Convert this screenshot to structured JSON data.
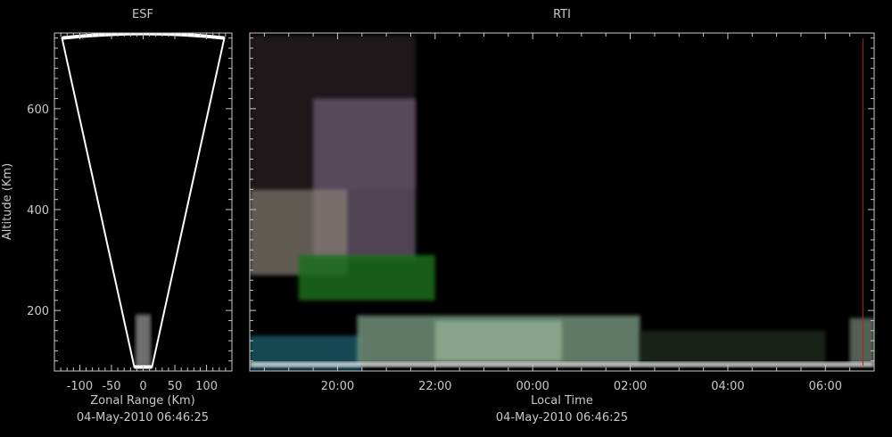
{
  "colors": {
    "background": "#000000",
    "axis": "#c8c8c8",
    "fan_outline": "#ffffff",
    "marker": "#b02020"
  },
  "chart_data": [
    {
      "panel": "ESF",
      "type": "heatmap",
      "title": "ESF",
      "xlabel": "Zonal Range (Km)",
      "ylabel": "Altitude (Km)",
      "timestamp": "04-May-2010 06:46:25",
      "xlim": [
        -140,
        140
      ],
      "ylim": [
        80,
        750
      ],
      "xticks": [
        -100,
        -50,
        0,
        50,
        100
      ],
      "xtick_labels": [
        "-100",
        "-50",
        "0",
        "50",
        "100"
      ],
      "yticks": [
        200,
        400,
        600
      ],
      "ytick_labels": [
        "200",
        "400",
        "600"
      ],
      "fan": {
        "bottom_halfwidth": 14,
        "bottom_altitude": 88,
        "top_halfwidth": 128,
        "top_altitude": 745
      },
      "echo": {
        "x_range": [
          -12,
          12
        ],
        "alt_range": [
          88,
          192
        ],
        "color": "#8a8a8a"
      }
    },
    {
      "panel": "RTI",
      "type": "heatmap",
      "title": "RTI",
      "xlabel": "Local Time",
      "timestamp": "04-May-2010 06:46:25",
      "xlim_hours": [
        18.2,
        31.0
      ],
      "ylim": [
        80,
        750
      ],
      "xticks_hours": [
        20,
        22,
        24,
        26,
        28,
        30
      ],
      "xtick_labels": [
        "20:00",
        "22:00",
        "00:00",
        "02:00",
        "04:00",
        "06:00"
      ],
      "current_time_hours": 30.77,
      "regions": [
        {
          "t": [
            18.2,
            21.6
          ],
          "alt": [
            440,
            745
          ],
          "color": "#3a2a30",
          "opacity": 0.55
        },
        {
          "t": [
            19.5,
            21.6
          ],
          "alt": [
            300,
            620
          ],
          "color": "#6a5a70",
          "opacity": 0.75
        },
        {
          "t": [
            18.2,
            20.2
          ],
          "alt": [
            270,
            440
          ],
          "color": "#8a8278",
          "opacity": 0.7
        },
        {
          "t": [
            19.2,
            22.0
          ],
          "alt": [
            220,
            310
          ],
          "color": "#1f6e1f",
          "opacity": 0.85
        },
        {
          "t": [
            18.2,
            20.5
          ],
          "alt": [
            80,
            150
          ],
          "color": "#1a5a6a",
          "opacity": 0.8
        },
        {
          "t": [
            20.4,
            26.2
          ],
          "alt": [
            95,
            190
          ],
          "color": "#6f8f78",
          "opacity": 0.85
        },
        {
          "t": [
            22.0,
            24.6
          ],
          "alt": [
            100,
            180
          ],
          "color": "#a8c8a8",
          "opacity": 0.55
        },
        {
          "t": [
            26.2,
            30.0
          ],
          "alt": [
            95,
            160
          ],
          "color": "#2a3a2a",
          "opacity": 0.6
        },
        {
          "t": [
            30.5,
            31.0
          ],
          "alt": [
            95,
            185
          ],
          "color": "#7a8a7a",
          "opacity": 0.7
        },
        {
          "t": [
            18.2,
            31.0
          ],
          "alt": [
            88,
            98
          ],
          "color": "#e8e8e8",
          "opacity": 0.9
        }
      ]
    }
  ]
}
